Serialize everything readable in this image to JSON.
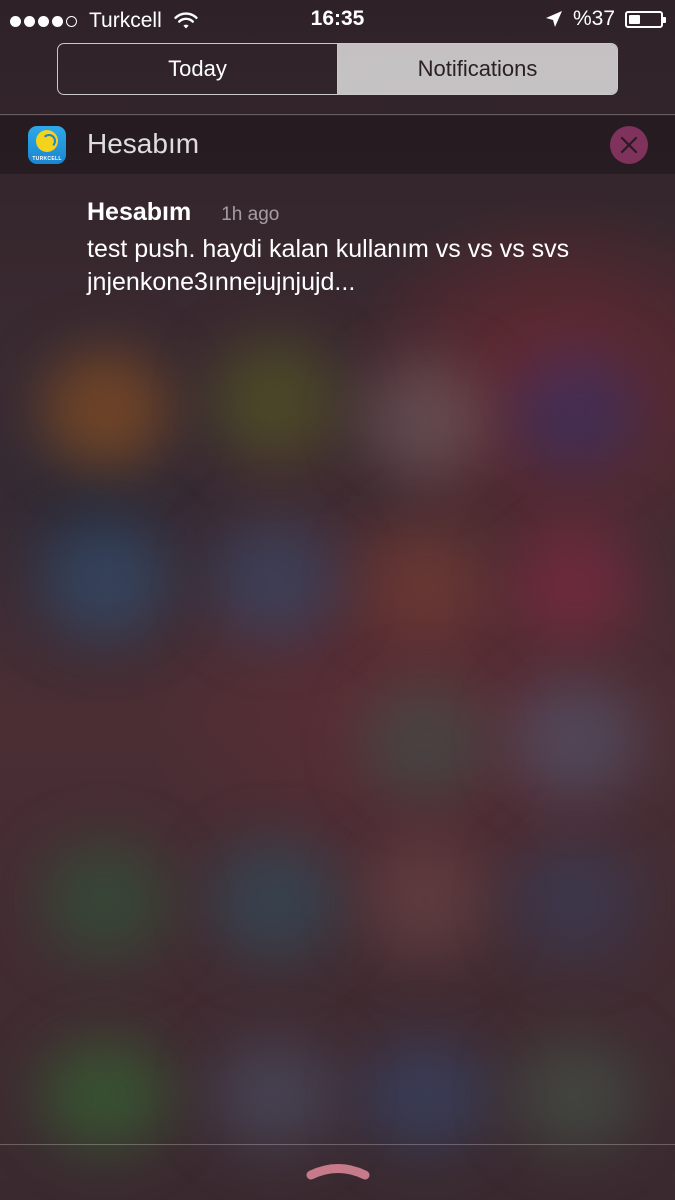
{
  "status_bar": {
    "signal_dots_filled": 4,
    "signal_dots_total": 5,
    "carrier": "Turkcell",
    "time": "16:35",
    "battery_text": "%37",
    "battery_level": 0.37,
    "icons": [
      "wifi-icon",
      "location-arrow-icon",
      "battery-icon"
    ]
  },
  "tabs": {
    "today": "Today",
    "notifications": "Notifications",
    "selected": "notifications"
  },
  "group": {
    "app_name": "Hesabım",
    "icon_brand": "TURKCELL"
  },
  "notification": {
    "title": "Hesabım",
    "time_ago": "1h ago",
    "body": "test push. haydi kalan kullanım vs vs vs svs jnjenkone3ınnejujnjujd..."
  },
  "colors": {
    "accent_clear": "#c8468c",
    "app_icon": "#1a86d0",
    "logo_yellow": "#f5d21c"
  }
}
